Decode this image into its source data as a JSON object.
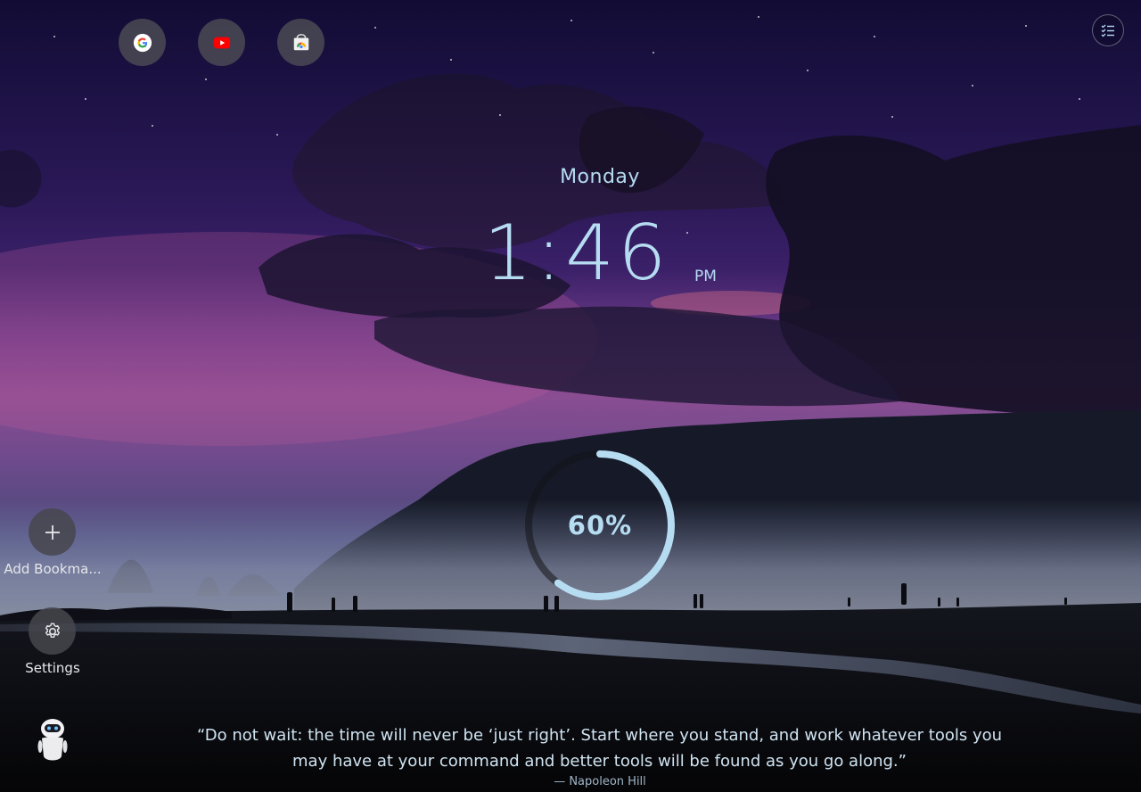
{
  "shortcuts": [
    {
      "name": "google",
      "icon": "google-icon"
    },
    {
      "name": "youtube",
      "icon": "youtube-icon"
    },
    {
      "name": "chrome-web-store",
      "icon": "chrome-web-store-icon"
    }
  ],
  "clock": {
    "day": "Monday",
    "time": "1:46",
    "period": "PM"
  },
  "progress": {
    "label": "60%",
    "value": 0.6,
    "color": "#b6dcf2"
  },
  "sidebar": {
    "add_bookmark_label": "Add Bookma...",
    "settings_label": "Settings"
  },
  "quote": {
    "text": "“Do not wait: the time will never be ‘just right’. Start where you stand, and work whatever tools you may have at your command and better tools will be found as you go along.”",
    "author": "— Napoleon Hill"
  },
  "colors": {
    "accent": "#b6dcf2",
    "button_bg": "#505056"
  }
}
